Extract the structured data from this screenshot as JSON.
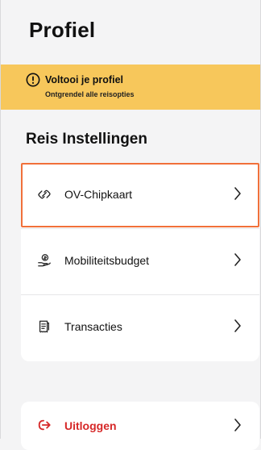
{
  "header": {
    "title": "Profiel"
  },
  "banner": {
    "title": "Voltooi je profiel",
    "subtitle": "Ontgrendel alle reisopties",
    "background": "#f7c75b",
    "icon": "exclamation-circle-icon"
  },
  "section": {
    "title": "Reis Instellingen"
  },
  "settings": {
    "items": [
      {
        "label": "OV-Chipkaart",
        "icon": "card-link-icon",
        "highlighted": true
      },
      {
        "label": "Mobiliteitsbudget",
        "icon": "hand-coin-icon"
      },
      {
        "label": "Transacties",
        "icon": "receipt-icon"
      }
    ]
  },
  "logout": {
    "label": "Uitloggen",
    "icon": "logout-arrow-icon",
    "color": "#d62828"
  },
  "colors": {
    "highlight": "#f1703a",
    "background": "#f4f4f5"
  }
}
